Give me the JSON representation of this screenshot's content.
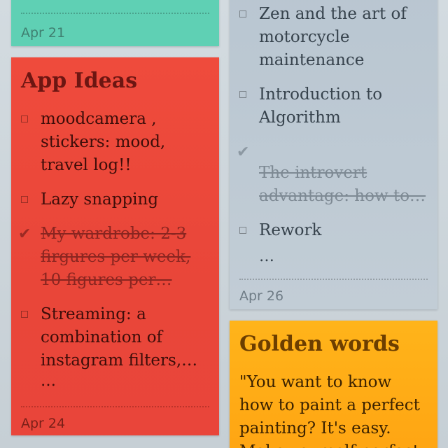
{
  "notes": {
    "teal": {
      "date": "Apr 21",
      "color": "#5fd0b4"
    },
    "app_ideas": {
      "title": "App Ideas",
      "color": "#ef4b3c",
      "items": [
        {
          "text": "moodcamera , stickers: mood, travel log!!",
          "checked": false
        },
        {
          "text": "Lazy snapping",
          "checked": false
        },
        {
          "text": "My wardrobe: 2-3 firgures per week, 10 figures per…",
          "checked": true
        },
        {
          "text": "Streaming: a combination of instagram filters,…",
          "checked": false
        }
      ],
      "ellipsis": "…",
      "date": "Apr 24"
    },
    "books": {
      "color": "#b9c6d1",
      "items": [
        {
          "text": "Zen and the art of motorcycle maintenance",
          "checked": false
        },
        {
          "text": "Introduction to Algorithm",
          "checked": false
        },
        {
          "text": "The introvert advantage: how to…",
          "checked": true
        },
        {
          "text": "Rework",
          "checked": false
        }
      ],
      "ellipsis": "…",
      "date": "Apr 26"
    },
    "golden_words": {
      "title": "Golden words",
      "color": "#ffb41a",
      "body": "\"You want to know how to paint a perfect painting? It's easy. Make yourself perfect"
    }
  },
  "icons": {
    "checkbox": "checkbox-empty-icon",
    "checkmark": "checkmark-icon"
  }
}
